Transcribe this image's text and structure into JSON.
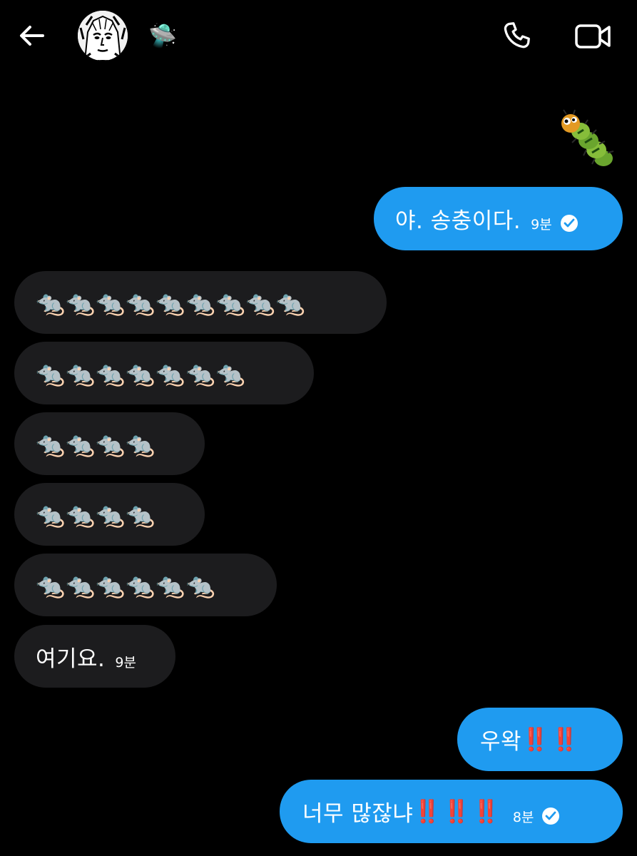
{
  "header": {
    "back_icon": "arrow-left-icon",
    "avatar_icon": "profile-avatar",
    "status_emoji": "🛸",
    "call_icon": "phone-icon",
    "video_icon": "video-camera-icon"
  },
  "colors": {
    "background": "#000000",
    "outgoing_bubble": "#1f9bf0",
    "incoming_bubble": "#1c1c1e",
    "exclamation": "#e0262e"
  },
  "sticker": {
    "icon": "caterpillar-sticker"
  },
  "messages": {
    "m1": {
      "text": "야. 송충이다.",
      "time": "9분"
    },
    "r1": {
      "text": "🐀🐀🐀🐀🐀🐀🐀🐀🐀"
    },
    "r2": {
      "text": "🐀🐀🐀🐀🐀🐀🐀"
    },
    "r3": {
      "text": "🐀🐀🐀🐀"
    },
    "r4": {
      "text": "🐀🐀🐀🐀"
    },
    "r5": {
      "text": "🐀🐀🐀🐀🐀🐀"
    },
    "r6": {
      "text": "여기요.",
      "time": "9분"
    },
    "m2": {
      "text": "우왁",
      "excl": "‼️ ‼️"
    },
    "m3": {
      "text": "너무 많잖냐",
      "excl": "‼️ ‼️ ‼️",
      "time": "8분"
    }
  }
}
